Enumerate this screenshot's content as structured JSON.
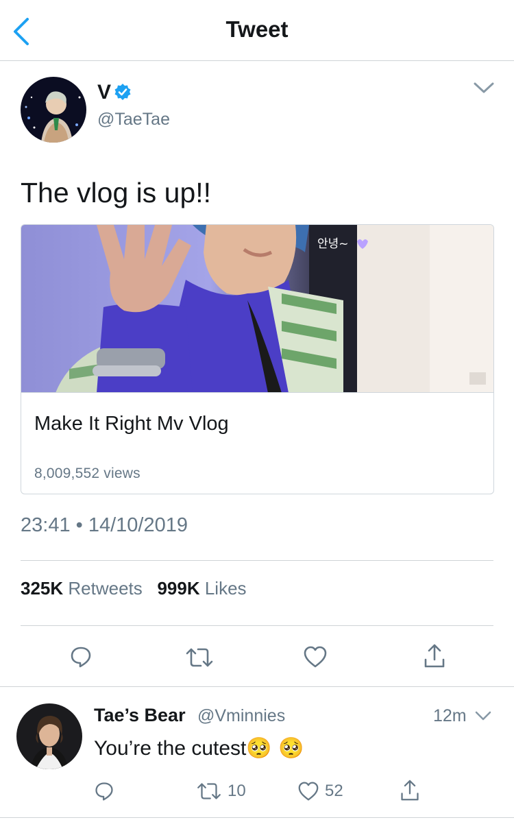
{
  "navbar": {
    "title": "Tweet"
  },
  "tweet": {
    "author_name": "V",
    "author_handle": "@TaeTae",
    "text": "The vlog is up!!",
    "card": {
      "title": "Make It Right Mv Vlog",
      "views": "8,009,552 views",
      "overlay_text": "안녕~"
    },
    "timestamp": "23:41 • 14/10/2019",
    "retweets_count": "325K",
    "retweets_label": "Retweets",
    "likes_count": "999K",
    "likes_label": "Likes"
  },
  "reply": {
    "author_name": "Tae’s Bear",
    "author_handle": "@Vminnies",
    "time": "12m",
    "text": "You’re the cutest",
    "emoji": "🥺 🥺",
    "retweet_count": "10",
    "like_count": "52"
  },
  "colors": {
    "accent": "#1da1f2",
    "text_primary": "#14171a",
    "text_secondary": "#657786",
    "divider": "#cfd3d6"
  },
  "icons": [
    "back-chevron-icon",
    "verified-badge-icon",
    "chevron-down-icon",
    "reply-icon",
    "retweet-icon",
    "like-icon",
    "share-icon"
  ]
}
